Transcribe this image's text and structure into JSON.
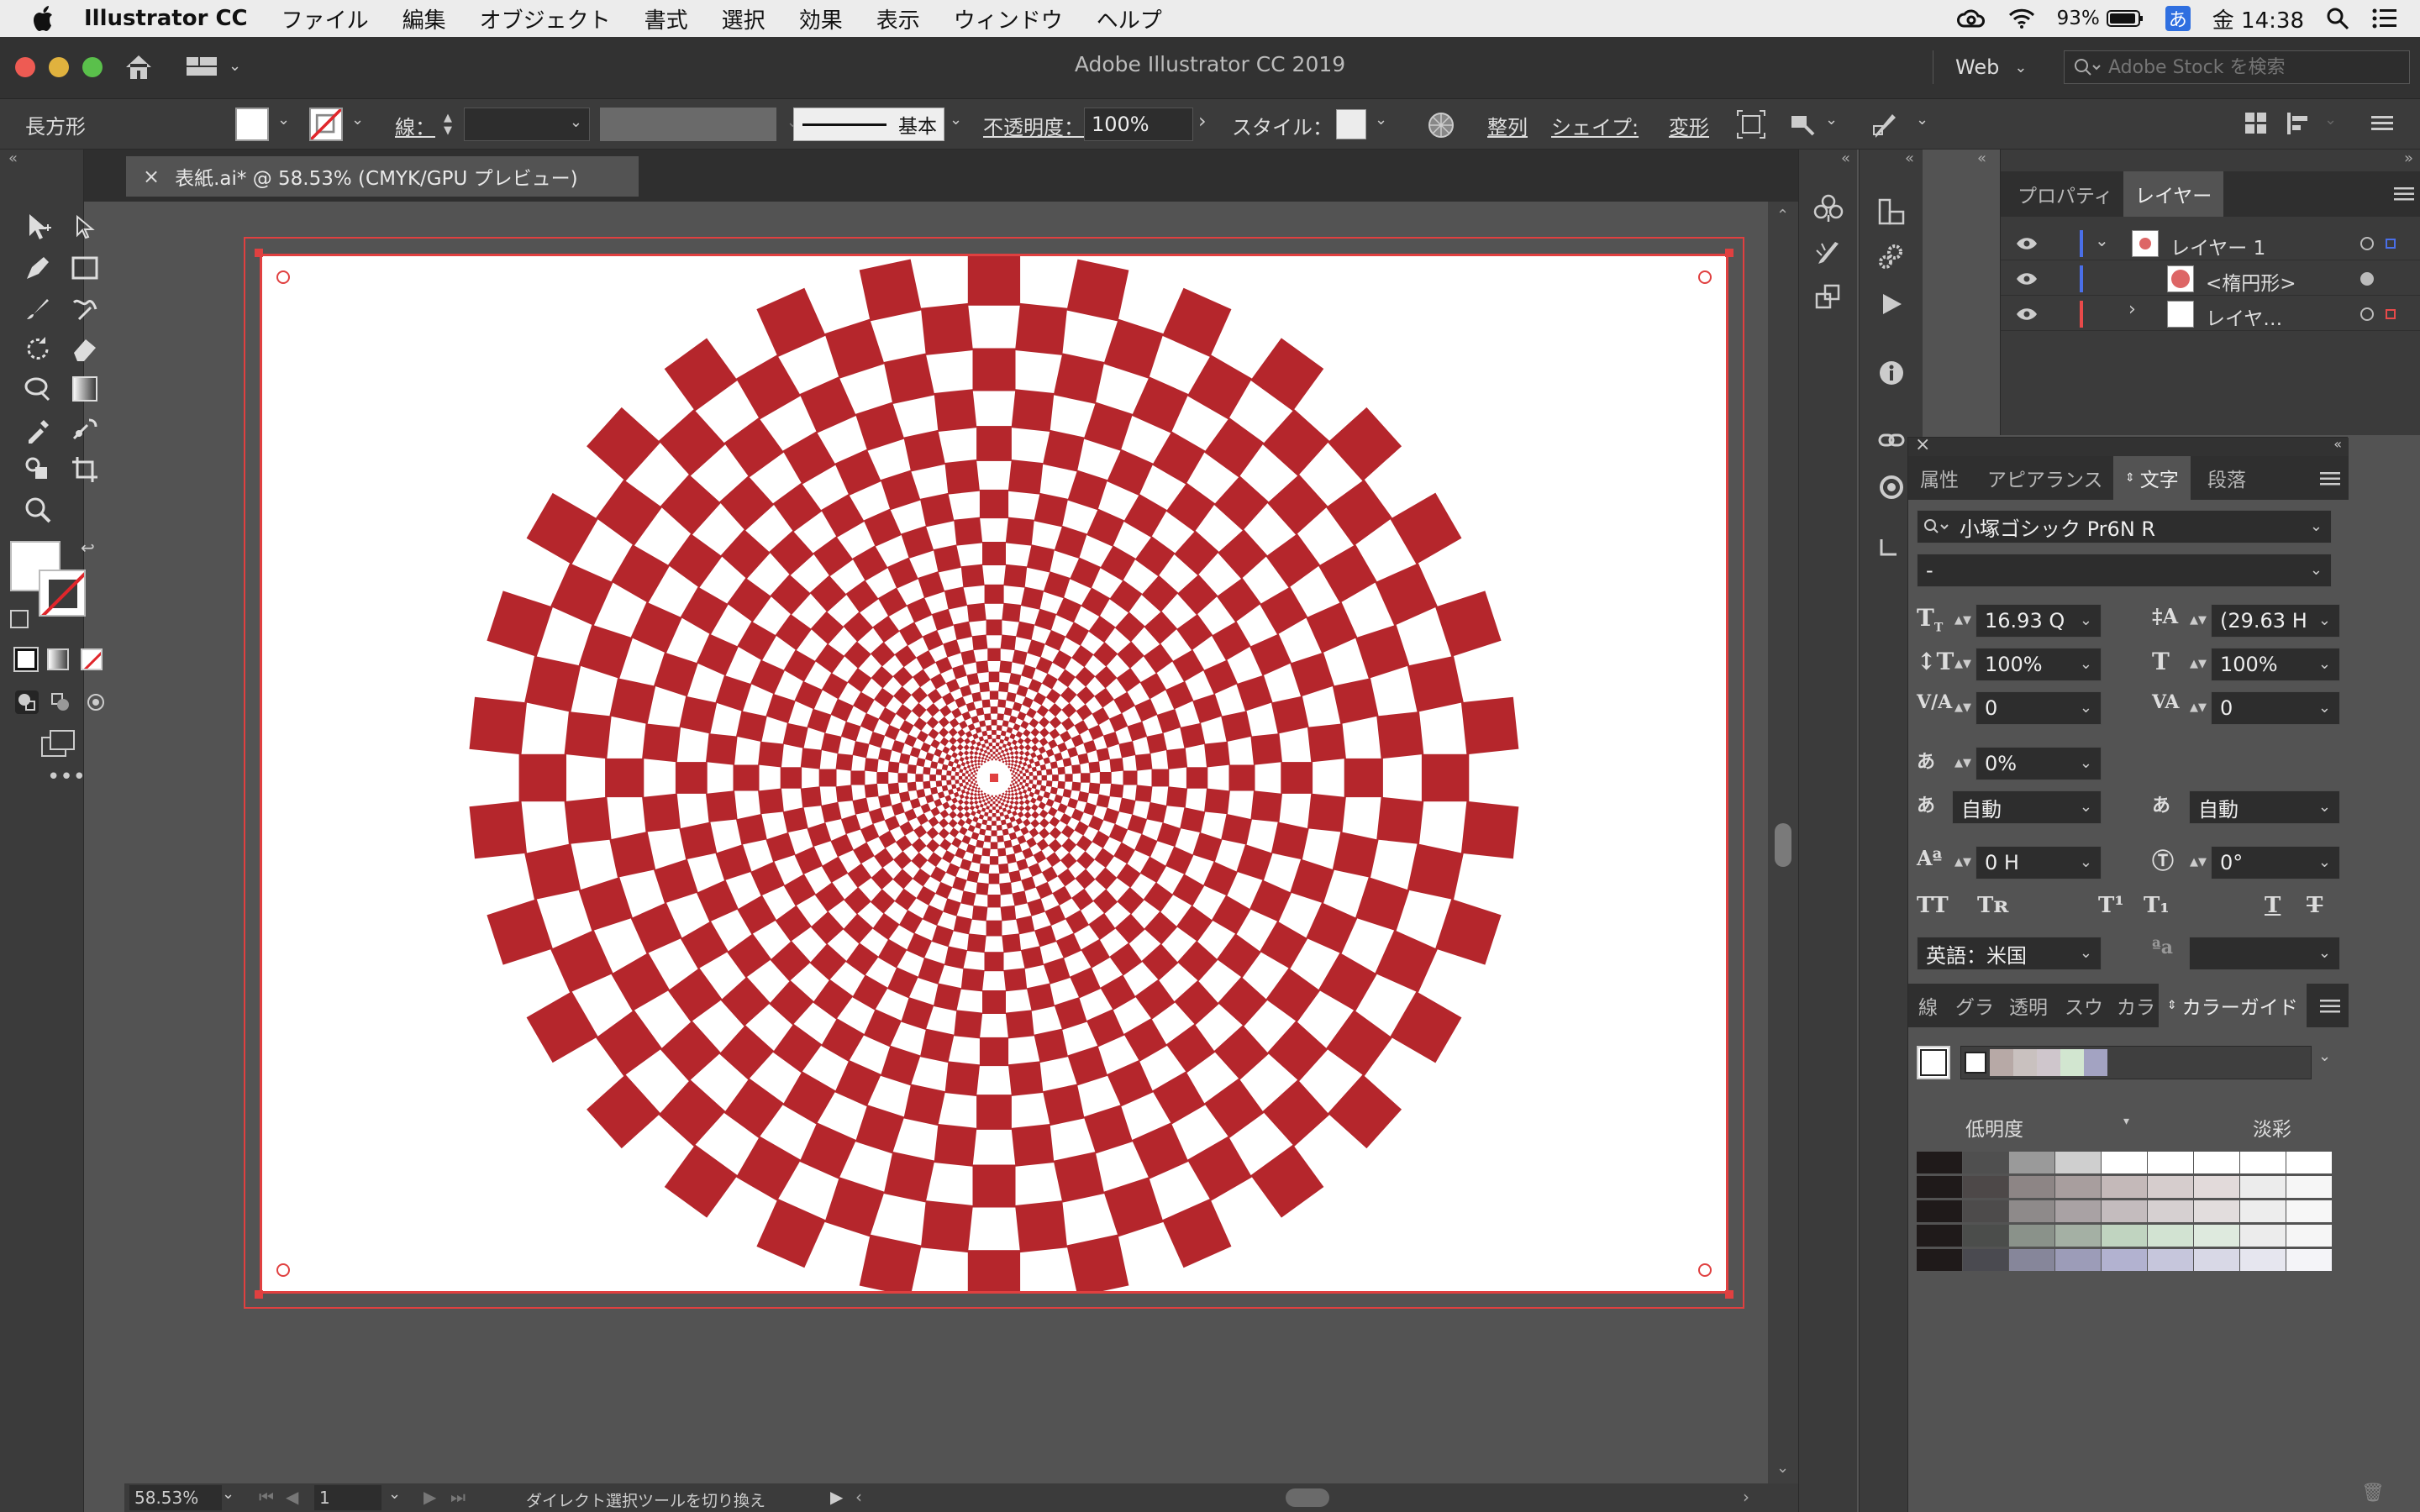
{
  "menubar": {
    "app_name": "Illustrator CC",
    "items": [
      "ファイル",
      "編集",
      "オブジェクト",
      "書式",
      "選択",
      "効果",
      "表示",
      "ウィンドウ",
      "ヘルプ"
    ],
    "battery": "93%",
    "input_method": "あ",
    "clock": "金 14:38"
  },
  "window": {
    "title": "Adobe Illustrator CC 2019",
    "workspace": "Web",
    "search_placeholder": "Adobe Stock を検索"
  },
  "control_bar": {
    "object_type": "長方形",
    "stroke_label": "線：",
    "stroke_style": "基本",
    "opacity_label": "不透明度：",
    "opacity_value": "100%",
    "style_label": "スタイル：",
    "align_label": "整列",
    "shape_label": "シェイプ:",
    "transform_label": "変形"
  },
  "document": {
    "tab_title": "表紙.ai* @ 58.53% (CMYK/GPU プレビュー)",
    "zoom": "58.53%",
    "artboard_number": "1",
    "status_text": "ダイレクト選択ツールを切り換え"
  },
  "layers_panel": {
    "tabs": [
      "プロパティ",
      "レイヤー"
    ],
    "rows": [
      {
        "name": "レイヤー 1",
        "color": "#4a6fe8"
      },
      {
        "name": "<楕円形>",
        "color": "#4a6fe8"
      },
      {
        "name": "レイヤ…",
        "color": "#e84a4a"
      }
    ]
  },
  "char_panel": {
    "tabs": [
      "属性",
      "アピアランス",
      "文字",
      "段落"
    ],
    "font_family": "小塚ゴシック Pr6N R",
    "font_style": "-",
    "font_size": "16.93 Q",
    "leading": "(29.63 H",
    "vertical_scale": "100%",
    "horizontal_scale": "100%",
    "kerning": "0",
    "tracking": "0",
    "tsume": "0%",
    "aki_left": "自動",
    "aki_right": "自動",
    "baseline_shift": "0 H",
    "rotation": "0°",
    "language": "英語：米国"
  },
  "color_guide": {
    "tabs": [
      "線",
      "グラ",
      "透明",
      "スウ",
      "カラ",
      "カラーガイド"
    ],
    "left_label": "低明度",
    "right_label": "淡彩",
    "strip": [
      "#ffffff",
      "#b7a9a6",
      "#c9c1bf",
      "#cfc6cc",
      "#d2e6d0",
      "#a3a3c2"
    ],
    "grid": [
      [
        "#1f1a1a",
        "#4f4f4f",
        "#9a9a9a",
        "#cfcfcf",
        "#ffffff",
        "#ffffff",
        "#ffffff",
        "#ffffff",
        "#ffffff"
      ],
      [
        "#1f1a1a",
        "#4d4848",
        "#8d8585",
        "#a89e9e",
        "#c4b9b9",
        "#d6cdcd",
        "#e2dada",
        "#ececec",
        "#f6f6f6"
      ],
      [
        "#1f1a1a",
        "#4d4b4b",
        "#8e8a8a",
        "#a9a2a4",
        "#c4bcbe",
        "#d6d0d1",
        "#e2dddd",
        "#ededed",
        "#f7f7f7"
      ],
      [
        "#1f1a1a",
        "#4b4d4b",
        "#8a928a",
        "#a4b0a4",
        "#c0d4c0",
        "#d2e3d2",
        "#deeade",
        "#ececec",
        "#f6f6f6"
      ],
      [
        "#1f1a1a",
        "#4a4a50",
        "#86869a",
        "#9c9cb8",
        "#b2b2d0",
        "#c6c6dc",
        "#d8d8e6",
        "#e6e6ef",
        "#f4f4f8"
      ]
    ]
  },
  "artwork": {
    "fill": "#b5262c"
  }
}
